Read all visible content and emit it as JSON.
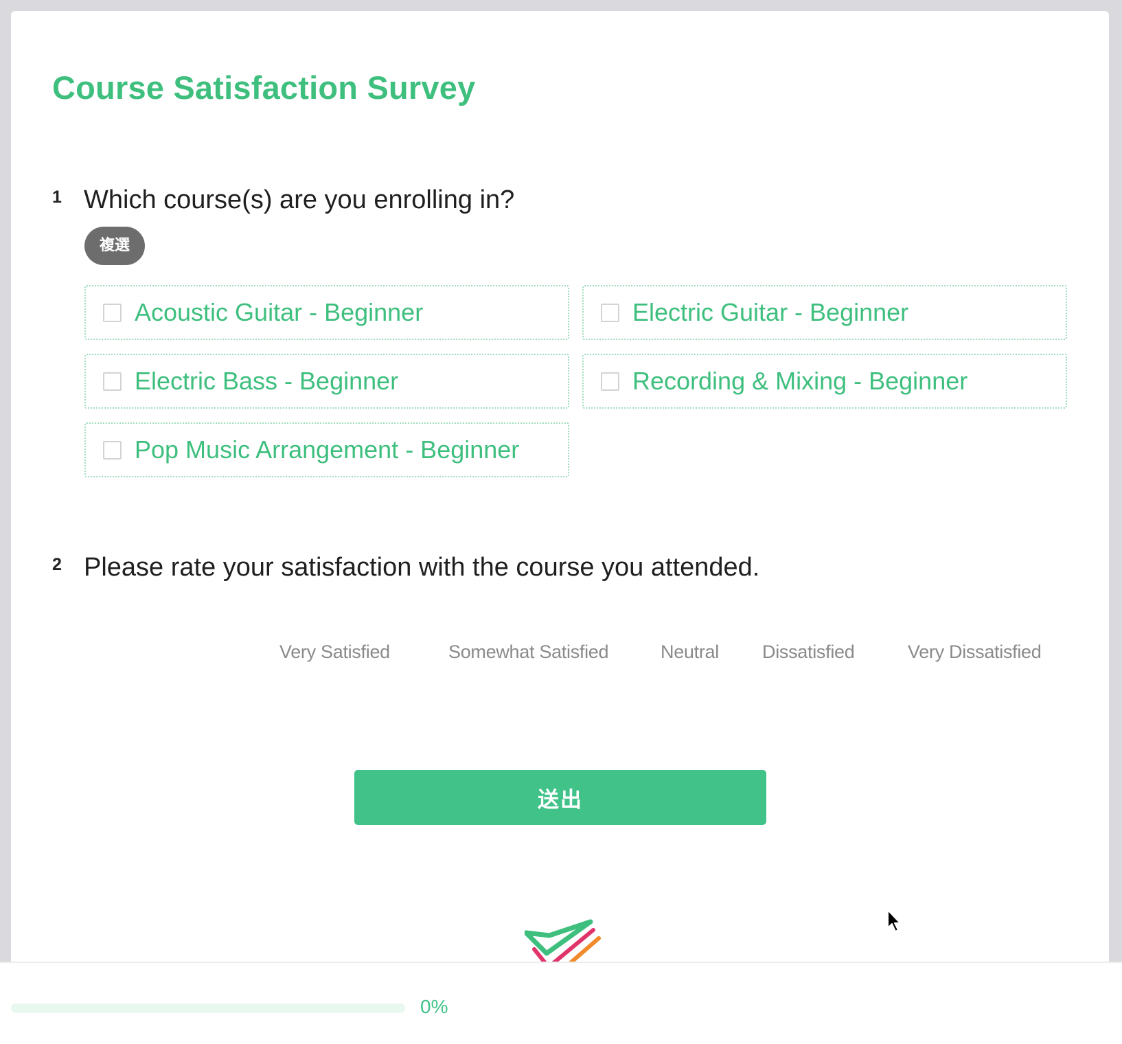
{
  "survey": {
    "title": "Course Satisfaction Survey"
  },
  "questions": [
    {
      "number": "1",
      "text": "Which course(s) are you enrolling in?",
      "badge": "複選",
      "options": [
        {
          "label": "Acoustic Guitar - Beginner",
          "checked": false
        },
        {
          "label": "Electric Guitar - Beginner",
          "checked": false
        },
        {
          "label": "Electric Bass - Beginner",
          "checked": false
        },
        {
          "label": "Recording & Mixing - Beginner",
          "checked": false
        },
        {
          "label": "Pop Music Arrangement - Beginner",
          "checked": false
        }
      ]
    },
    {
      "number": "2",
      "text": "Please rate your satisfaction with the course you attended.",
      "scale": [
        "Very Satisfied",
        "Somewhat Satisfied",
        "Neutral",
        "Dissatisfied",
        "Very Dissatisfied"
      ]
    }
  ],
  "submit": {
    "label": "送出"
  },
  "progress": {
    "percent": 0,
    "text": "0%"
  },
  "colors": {
    "accent": "#3ebf7e",
    "button": "#41c289",
    "badge": "#6d6d6d",
    "progress_track": "#e8f8ef"
  },
  "icons": {
    "logo": "check-logo-icon",
    "cursor": "mouse-pointer-icon"
  }
}
